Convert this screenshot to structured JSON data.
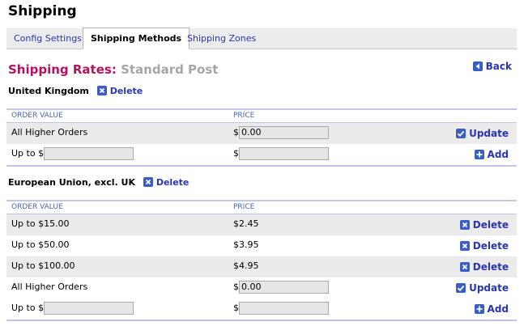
{
  "page": {
    "title": "Shipping"
  },
  "tabs": [
    {
      "label": "Config Settings",
      "active": false
    },
    {
      "label": "Shipping Methods",
      "active": true
    },
    {
      "label": "Shipping Zones",
      "active": false
    }
  ],
  "rates": {
    "title": "Shipping Rates:",
    "method": "Standard Post",
    "back_label": "Back"
  },
  "columns": {
    "order_value": "ORDER VALUE",
    "price": "PRICE"
  },
  "zones": [
    {
      "name": "United Kingdom",
      "delete_label": "Delete",
      "rows": [
        {
          "order": "All Higher Orders",
          "price_prefix": "$",
          "price_value": "0.00",
          "action": "Update"
        }
      ],
      "add_row": {
        "order_prefix": "Up to $",
        "order_value": "",
        "price_prefix": "$",
        "price_value": "",
        "action": "Add"
      }
    },
    {
      "name": "European Union, excl. UK",
      "delete_label": "Delete",
      "rows": [
        {
          "order": "Up to $15.00",
          "price": "$2.45",
          "action": "Delete"
        },
        {
          "order": "Up to $50.00",
          "price": "$3.95",
          "action": "Delete"
        },
        {
          "order": "Up to $100.00",
          "price": "$4.95",
          "action": "Delete"
        },
        {
          "order": "All Higher Orders",
          "price_prefix": "$",
          "price_value": "0.00",
          "action": "Update"
        }
      ],
      "add_row": {
        "order_prefix": "Up to $",
        "order_value": "",
        "price_prefix": "$",
        "price_value": "",
        "action": "Add"
      }
    }
  ],
  "colors": {
    "accent": "#b3125e",
    "link": "#2a35b0",
    "icon": "#3b5fc0",
    "header_line": "#c4c4ea",
    "row_shade": "#ebebeb"
  },
  "icons": {
    "back": "back-arrow-icon",
    "delete": "delete-x-icon",
    "update": "check-icon",
    "add": "plus-icon"
  }
}
